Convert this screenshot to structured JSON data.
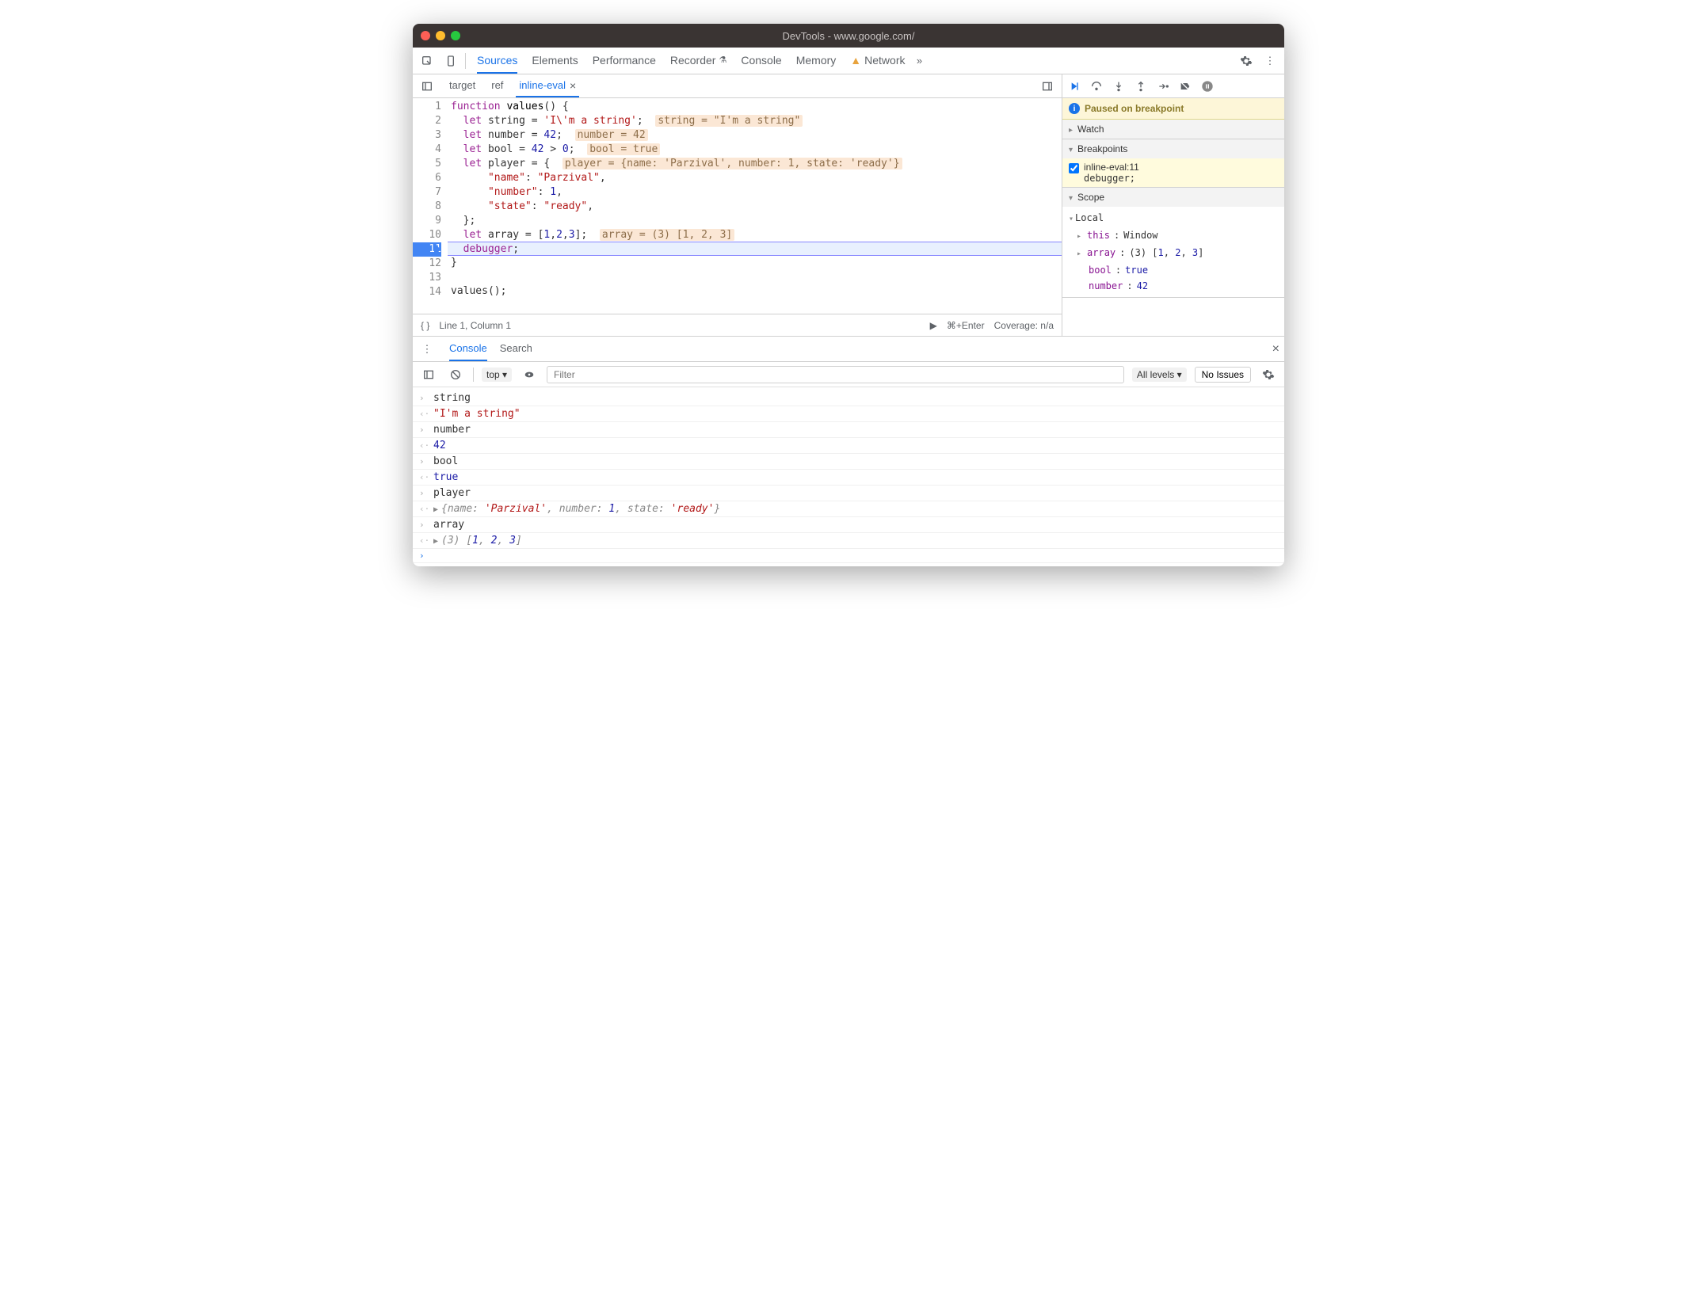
{
  "window": {
    "title": "DevTools - www.google.com/"
  },
  "tabs": [
    "Sources",
    "Elements",
    "Performance",
    "Recorder",
    "Console",
    "Memory",
    "Network"
  ],
  "active_tab": "Sources",
  "warning_tab": "Network",
  "file_tabs": [
    {
      "label": "target",
      "active": false
    },
    {
      "label": "ref",
      "active": false
    },
    {
      "label": "inline-eval",
      "active": true,
      "closable": true
    }
  ],
  "code_lines": [
    {
      "n": 1,
      "html": "<span class='kw'>function</span> <span class='fn'>values</span>() {"
    },
    {
      "n": 2,
      "html": "  <span class='kw'>let</span> string = <span class='str'>'I\\'m a string'</span>;  <span class='hint'>string = \"I'm a string\"</span>"
    },
    {
      "n": 3,
      "html": "  <span class='kw'>let</span> number = <span class='num'>42</span>;  <span class='hint'>number = 42</span>"
    },
    {
      "n": 4,
      "html": "  <span class='kw'>let</span> bool = <span class='num'>42</span> > <span class='num'>0</span>;  <span class='hint'>bool = true</span>"
    },
    {
      "n": 5,
      "html": "  <span class='kw'>let</span> player = {  <span class='hint'>player = {name: 'Parzival', number: 1, state: 'ready'}</span>"
    },
    {
      "n": 6,
      "html": "      <span class='prop'>\"name\"</span>: <span class='str'>\"Parzival\"</span>,"
    },
    {
      "n": 7,
      "html": "      <span class='prop'>\"number\"</span>: <span class='num'>1</span>,"
    },
    {
      "n": 8,
      "html": "      <span class='prop'>\"state\"</span>: <span class='str'>\"ready\"</span>,"
    },
    {
      "n": 9,
      "html": "  };"
    },
    {
      "n": 10,
      "html": "  <span class='kw'>let</span> array = [<span class='num'>1</span>,<span class='num'>2</span>,<span class='num'>3</span>];  <span class='hint'>array = (3) [1, 2, 3]</span>"
    },
    {
      "n": 11,
      "html": "  <span class='kw'>debugger</span>;",
      "current": true
    },
    {
      "n": 12,
      "html": "}"
    },
    {
      "n": 13,
      "html": ""
    },
    {
      "n": 14,
      "html": "values();"
    }
  ],
  "statusbar": {
    "position": "Line 1, Column 1",
    "run_hint": "⌘+Enter",
    "coverage": "Coverage: n/a"
  },
  "debugger": {
    "paused_message": "Paused on breakpoint",
    "sections": {
      "watch": "Watch",
      "breakpoints": "Breakpoints",
      "scope": "Scope"
    },
    "breakpoints": [
      {
        "label": "inline-eval:11",
        "code": "debugger;",
        "checked": true
      }
    ],
    "scope": {
      "Local": [
        {
          "k": "this",
          "v": "Window",
          "expandable": true
        },
        {
          "k": "array",
          "v": "(3) [1, 2, 3]",
          "expandable": true,
          "isarray": true
        },
        {
          "k": "bool",
          "v": "true",
          "type": "num"
        },
        {
          "k": "number",
          "v": "42",
          "type": "num"
        }
      ]
    }
  },
  "drawer": {
    "tabs": [
      "Console",
      "Search"
    ],
    "active": "Console",
    "context": "top",
    "filter_placeholder": "Filter",
    "levels": "All levels",
    "issues": "No Issues"
  },
  "console_log": [
    {
      "type": "in",
      "text": "string"
    },
    {
      "type": "out",
      "html": "<span class='cred'>\"I'm a string\"</span>"
    },
    {
      "type": "in",
      "text": "number"
    },
    {
      "type": "out",
      "html": "<span class='cblue'>42</span>"
    },
    {
      "type": "in",
      "text": "bool"
    },
    {
      "type": "out",
      "html": "<span class='cblue'>true</span>"
    },
    {
      "type": "in",
      "text": "player"
    },
    {
      "type": "out",
      "html": "<span class='expand'>▶</span><span class='cit'>{name: <span class='cred'>'Parzival'</span>, number: <span class='cblue'>1</span>, state: <span class='cred'>'ready'</span>}</span>"
    },
    {
      "type": "in",
      "text": "array"
    },
    {
      "type": "out",
      "html": "<span class='expand'>▶</span><span class='cit'>(3) </span><span class='cit'>[<span class='cblue'>1</span>, <span class='cblue'>2</span>, <span class='cblue'>3</span>]</span>"
    },
    {
      "type": "prompt",
      "text": ""
    }
  ]
}
